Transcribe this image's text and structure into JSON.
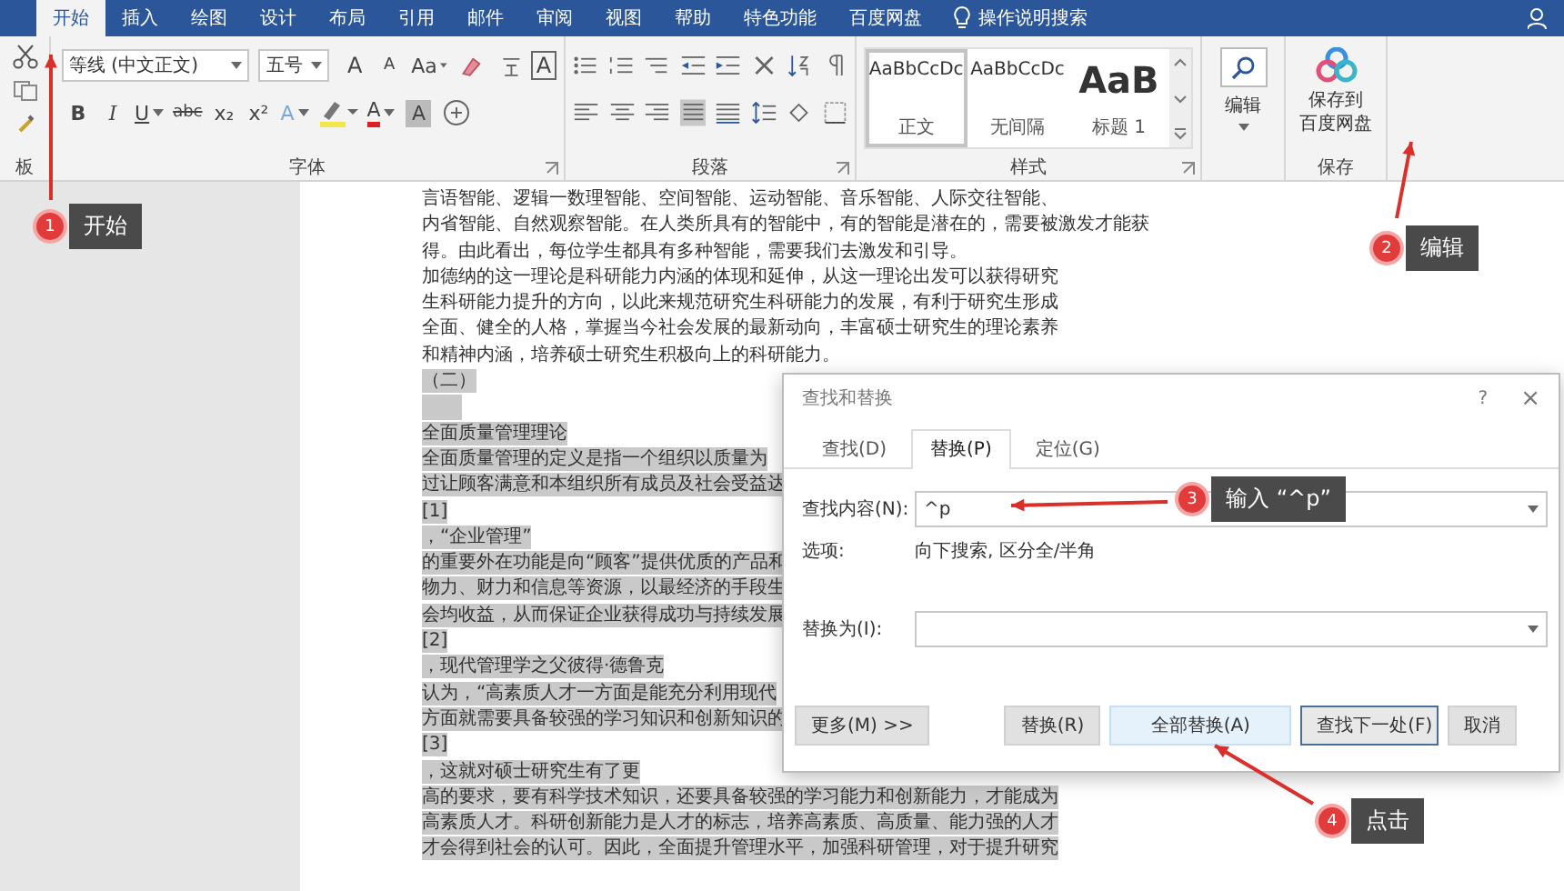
{
  "ribbon": {
    "tabs": [
      {
        "label": "开始",
        "selected": true
      },
      {
        "label": "插入",
        "selected": false
      },
      {
        "label": "绘图",
        "selected": false
      },
      {
        "label": "设计",
        "selected": false
      },
      {
        "label": "布局",
        "selected": false
      },
      {
        "label": "引用",
        "selected": false
      },
      {
        "label": "邮件",
        "selected": false
      },
      {
        "label": "审阅",
        "selected": false
      },
      {
        "label": "视图",
        "selected": false
      },
      {
        "label": "帮助",
        "selected": false
      },
      {
        "label": "特色功能",
        "selected": false
      },
      {
        "label": "百度网盘",
        "selected": false
      }
    ],
    "tell_me": "操作说明搜索",
    "clipboard": {
      "label": "板"
    },
    "font": {
      "label": "字体",
      "font_name": "等线 (中文正文)",
      "font_size": "五号",
      "row1": [
        {
          "kind": "grow",
          "text": "A"
        },
        {
          "kind": "shrink",
          "text": "A"
        },
        {
          "kind": "dropdown",
          "text": "Aa"
        },
        {
          "kind": "eraser"
        },
        {
          "kind": "phonetic"
        },
        {
          "kind": "bordered",
          "text": "A"
        }
      ],
      "row2": [
        {
          "kind": "bold",
          "text": "B"
        },
        {
          "kind": "italic",
          "text": "I"
        },
        {
          "kind": "underline",
          "text": "U"
        },
        {
          "kind": "strike",
          "text": "abc"
        },
        {
          "kind": "key",
          "text": "x₂"
        },
        {
          "kind": "key",
          "text": "x²"
        },
        {
          "kind": "effect",
          "text": "A"
        },
        {
          "kind": "highlighter"
        },
        {
          "kind": "font-color",
          "text": "A"
        },
        {
          "kind": "shaded",
          "text": "A"
        },
        {
          "kind": "enclose"
        }
      ]
    },
    "paragraph": {
      "label": "段落"
    },
    "styles": {
      "label": "样式",
      "items": [
        {
          "kind": "body",
          "sample": "AaBbCcDc",
          "name": "正文",
          "selected": true
        },
        {
          "kind": "body",
          "sample": "AaBbCcDc",
          "name": "无间隔",
          "selected": false
        },
        {
          "kind": "heading",
          "sample": "AaB",
          "name": "标题 1",
          "selected": false
        }
      ]
    },
    "editing": {
      "label": "编辑"
    },
    "save": {
      "button_lines": [
        "保存到",
        "百度网盘"
      ],
      "label": "保存"
    }
  },
  "document": {
    "lines": [
      {
        "text": "言语智能、逻辑一数理智能、空间智能、运动智能、音乐智能、人际交往智能、",
        "selected": false
      },
      {
        "text": "内省智能、自然观察智能。在人类所具有的智能中，有的智能是潜在的，需要被激发才能获",
        "selected": false
      },
      {
        "text": "得。由此看出，每位学生都具有多种智能，需要我们去激发和引导。",
        "selected": false
      },
      {
        "text": "加德纳的这一理论是科研能力内涵的体现和延伸，从这一理论出发可以获得研究",
        "selected": false
      },
      {
        "text": "生科研能力提升的方向，以此来规范研究生科研能力的发展，有利于研究生形成",
        "selected": false
      },
      {
        "text": "全面、健全的人格，掌握当今社会发展的最新动向，丰富硕士研究生的理论素养",
        "selected": false
      },
      {
        "text": "和精神内涵，培养硕士研究生积极向上的科研能力。",
        "selected": false
      },
      {
        "text": "（二）",
        "selected": true
      },
      {
        "selected": true
      },
      {
        "text": "全面质量管理理论",
        "selected": true
      },
      {
        "text": "全面质量管理的定义是指一个组织以质量为",
        "selected": true
      },
      {
        "text": "过让顾客满意和本组织所有成员及社会受益达",
        "selected": true
      },
      {
        "text": "[1]",
        "selected": true
      },
      {
        "text": "，“企业管理”",
        "selected": true
      },
      {
        "text": "的重要外在功能是向“顾客”提供优质的产品和",
        "selected": true
      },
      {
        "text": "物力、财力和信息等资源，以最经济的手段生",
        "selected": true
      },
      {
        "text": "会均收益，从而保证企业获得成功与持续发展",
        "selected": true
      },
      {
        "text": "[2]",
        "selected": true
      },
      {
        "text": "，现代管理学之父彼得·德鲁克",
        "selected": true
      },
      {
        "text": "认为，“高素质人才一方面是能充分利用现代",
        "selected": true
      },
      {
        "text": "方面就需要具备较强的学习知识和创新知识的",
        "selected": true
      },
      {
        "text": "[3]",
        "selected": true
      },
      {
        "text": "，这就对硕士研究生有了更",
        "selected": true
      },
      {
        "text": "高的要求，要有科学技术知识，还要具备较强的学习能力和创新能力，才能成为",
        "selected": true
      },
      {
        "text": "高素质人才。科研创新能力是人才的标志，培养高素质、高质量、能力强的人才",
        "selected": true
      },
      {
        "text": "才会得到社会的认可。因此，全面提升管理水平，加强科研管理，对于提升研究",
        "selected": true
      }
    ]
  },
  "dialog": {
    "title": "查找和替换",
    "help": "?",
    "close": "×",
    "tabs": [
      {
        "label": "查找(D)",
        "selected": false
      },
      {
        "label": "替换(P)",
        "selected": true
      },
      {
        "label": "定位(G)",
        "selected": false
      }
    ],
    "find_label": "查找内容(N):",
    "find_value": "^p",
    "options_label": "选项:",
    "options_value": "向下搜索, 区分全/半角",
    "replace_label": "替换为(I):",
    "buttons": [
      {
        "kind": "more",
        "label": "更多(M) >>"
      },
      {
        "kind": "normal",
        "label": "替换(R)"
      },
      {
        "kind": "highlighted",
        "label": "全部替换(A)"
      },
      {
        "kind": "default",
        "label": "查找下一处(F)"
      },
      {
        "kind": "normal",
        "label": "取消"
      }
    ]
  },
  "annotations": [
    {
      "number": "1",
      "label": "开始"
    },
    {
      "number": "2",
      "label": "编辑"
    },
    {
      "number": "3",
      "label": "输入 “^p”"
    },
    {
      "number": "4",
      "label": "点击"
    }
  ]
}
